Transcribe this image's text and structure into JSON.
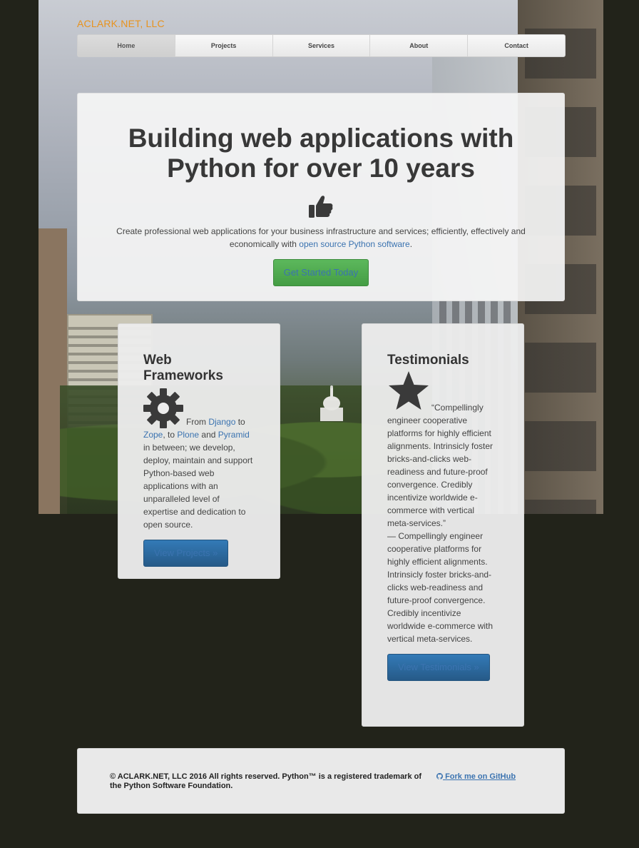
{
  "brand": "ACLARK.NET, LLC",
  "nav": [
    "Home",
    "Projects",
    "Services",
    "About",
    "Contact"
  ],
  "hero": {
    "heading_line1": "Building web applications with",
    "heading_line2": "Python for over 10 years",
    "intro": "Create professional web applications for your business infrastructure and services; efficiently, effectively and economically with",
    "intro_link": "open source Python software",
    "intro_end": ".",
    "cta": "Get Started Today"
  },
  "frameworks": {
    "title": "Web Frameworks",
    "t1": "From ",
    "django": "Django",
    "t2": " to ",
    "zope": "Zope",
    "t3": ", to ",
    "plone": "Plone",
    "t4": " and ",
    "pyramid": "Pyramid",
    "t5": " in between; we develop, deploy, maintain and support Python-based web applications with an unparalleled level of expertise and dedication to open source.",
    "button": "View Projects »"
  },
  "testimonials": {
    "title": "Testimonials",
    "quote": "“Compellingly engineer cooperative platforms for highly efficient alignments. Intrinsicly foster bricks-and-clicks web-readiness and future-proof convergence. Credibly incentivize worldwide e-commerce with vertical meta-services.”",
    "attribution": "— Compellingly engineer cooperative platforms for highly efficient alignments. Intrinsicly foster bricks-and-clicks web-readiness and future-proof convergence. Credibly incentivize worldwide e-commerce with vertical meta-services.",
    "button": "View Testimonials »"
  },
  "footer": {
    "copyright": "© ACLARK.NET, LLC 2016 All rights reserved. Python™ is a registered trademark of the Python Software Foundation.",
    "github": "Fork me on GitHub"
  },
  "colors": {
    "brand": "#e8931e",
    "link": "#3b73b0",
    "cta_green": "#5cb85c",
    "button_blue": "#337ab7",
    "page_bg": "#22231a"
  },
  "icons": [
    "thumbs-up-icon",
    "gear-icon",
    "star-icon",
    "github-icon"
  ]
}
